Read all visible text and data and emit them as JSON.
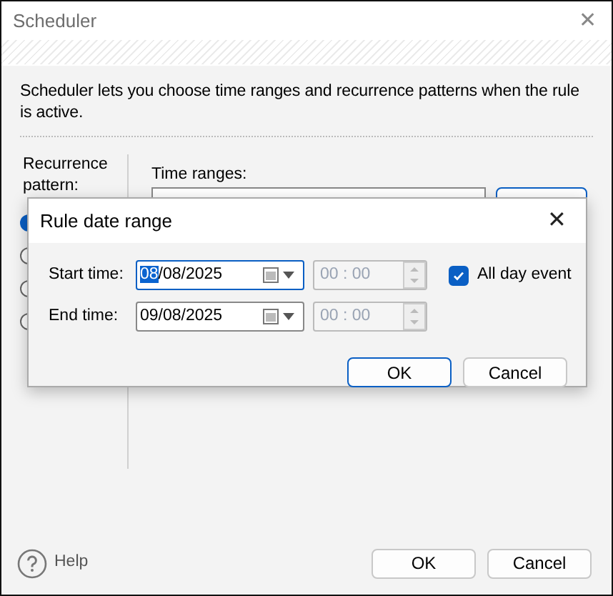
{
  "window": {
    "title": "Scheduler",
    "close": "✕"
  },
  "description": "Scheduler lets you choose time ranges and recurrence patterns when the rule is active.",
  "recurrence": {
    "label": "Recurrence pattern:",
    "options": [
      {
        "selected": true
      },
      {
        "selected": false
      },
      {
        "selected": false
      },
      {
        "selected": false
      }
    ]
  },
  "time_ranges": {
    "label": "Time ranges:"
  },
  "dialog": {
    "title": "Rule date range",
    "close": "✕",
    "rows": [
      {
        "label": "Start time:",
        "date": "08/08/2025",
        "focused": true,
        "time": "00 : 00",
        "time_disabled": true
      },
      {
        "label": "End time:",
        "date": "09/08/2025",
        "focused": false,
        "time": "00 : 00",
        "time_disabled": true
      }
    ],
    "all_day": {
      "label": "All day event",
      "checked": true
    },
    "buttons": [
      {
        "label": "OK",
        "default": true
      },
      {
        "label": "Cancel",
        "default": false
      }
    ]
  },
  "footer": {
    "help": "Help",
    "buttons": [
      {
        "label": "OK"
      },
      {
        "label": "Cancel"
      }
    ]
  }
}
